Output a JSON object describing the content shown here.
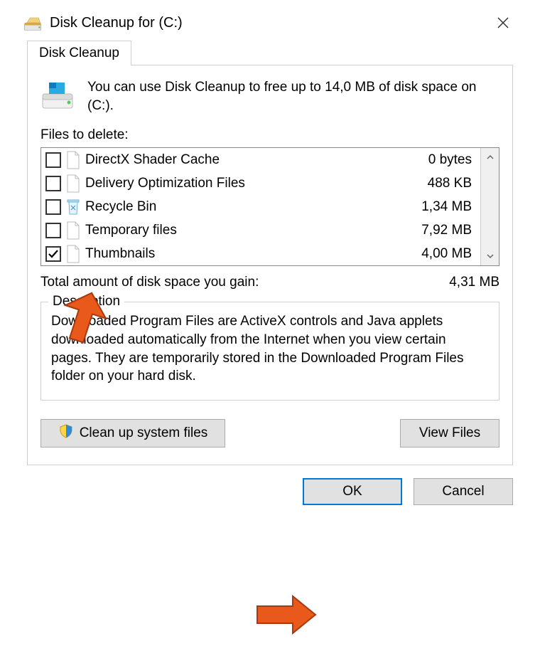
{
  "window": {
    "title": "Disk Cleanup for  (C:)"
  },
  "tab": {
    "label": "Disk Cleanup"
  },
  "intro": "You can use Disk Cleanup to free up to 14,0 MB of disk space on  (C:).",
  "files_label": "Files to delete:",
  "files": [
    {
      "checked": false,
      "icon": "file",
      "name": "DirectX Shader Cache",
      "size": "0 bytes"
    },
    {
      "checked": false,
      "icon": "file",
      "name": "Delivery Optimization Files",
      "size": "488 KB"
    },
    {
      "checked": false,
      "icon": "recycle",
      "name": "Recycle Bin",
      "size": "1,34 MB"
    },
    {
      "checked": false,
      "icon": "file",
      "name": "Temporary files",
      "size": "7,92 MB"
    },
    {
      "checked": true,
      "icon": "file",
      "name": "Thumbnails",
      "size": "4,00 MB"
    }
  ],
  "totals": {
    "label": "Total amount of disk space you gain:",
    "value": "4,31 MB"
  },
  "description": {
    "title": "Description",
    "text": "Downloaded Program Files are ActiveX controls and Java applets downloaded automatically from the Internet when you view certain pages. They are temporarily stored in the Downloaded Program Files folder on your hard disk."
  },
  "buttons": {
    "cleanup": "Clean up system files",
    "viewfiles": "View Files",
    "ok": "OK",
    "cancel": "Cancel"
  }
}
